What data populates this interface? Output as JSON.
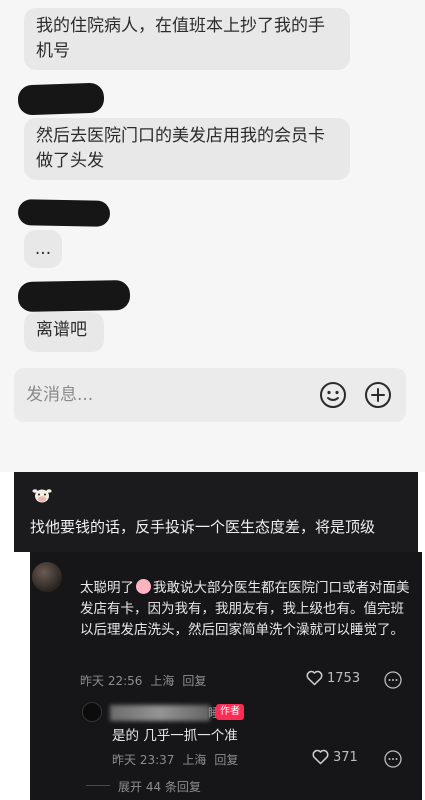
{
  "chat": {
    "messages": [
      {
        "text": "我的住院病人，在值班本上抄了我的手机号"
      },
      {
        "text": "然后去医院门口的美发店用我的会员卡做了头发"
      },
      {
        "text": "..."
      },
      {
        "text": "离谱吧"
      }
    ],
    "compose_placeholder": "发消息...",
    "icons": [
      "emoji-icon",
      "plus-icon"
    ]
  },
  "banner": {
    "icon": "cow-emoji-icon",
    "text": "找他要钱的话，反手投诉一个医生态度差，将是顶级"
  },
  "comments": {
    "top": {
      "text_prefix": "太聪明了",
      "text_body": "我敢说大部分医生都在医院门口或者对面美发店有卡，因为我有，我朋友有，我上级也有。值完班以后理发店洗头，然后回家简单洗个澡就可以睡觉了。",
      "time": "昨天 22:56",
      "location": "上海",
      "reply_label": "回复",
      "likes": "1753"
    },
    "reply": {
      "name_suffix": "睡",
      "author_tag": "作者",
      "text": "是的 几乎一抓一个准",
      "time": "昨天 23:37",
      "location": "上海",
      "reply_label": "回复",
      "likes": "371"
    },
    "expand_label": "展开 44 条回复"
  },
  "colors": {
    "author_tag": "#fe2c55",
    "chat_bg": "#f6f6f6",
    "bubble": "#e8e8e8",
    "dark_bg": "#161618"
  }
}
